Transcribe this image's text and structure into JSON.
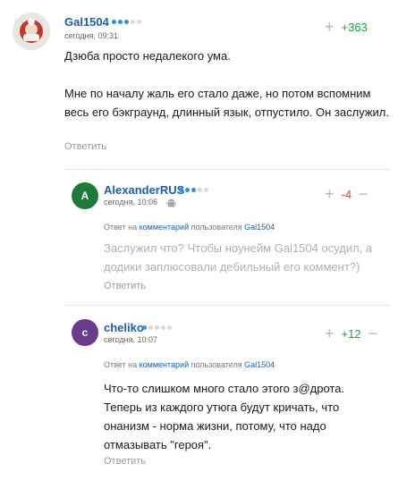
{
  "comments": [
    {
      "username": "Gal1504",
      "date": "сегодня, 09:31",
      "score": "+363",
      "text_p1": "Дзюба просто недалекого ума.",
      "text_p2": "Мне по началу жаль его стало даже, но потом вспомним весь его бэкграунд, длинный язык, отпустило. Он заслужил.",
      "reply_label": "Ответить",
      "rating_level": 3
    },
    {
      "username": "AlexanderRUS",
      "avatar_letter": "A",
      "avatar_color": "#1e7a3a",
      "date": "сегодня, 10:06",
      "score": "-4",
      "reply_to": {
        "prefix": "Ответ на",
        "link": "комментарий",
        "middle": "пользователя",
        "user": "Gal1504"
      },
      "text": "Заслужил что? Чтобы ноунейм Gal1504 осудил, а додики заплюсовали дебильный его коммент?)",
      "reply_label": "Ответить",
      "rating_level": 3
    },
    {
      "username": "cheliko",
      "avatar_letter": "c",
      "avatar_color": "#6a3a8c",
      "date": "сегодня, 10:07",
      "score": "+12",
      "reply_to": {
        "prefix": "Ответ на",
        "link": "комментарий",
        "middle": "пользователя",
        "user": "Gal1504"
      },
      "text": "Что-то слишком много стало этого з@дрота. Теперь из каждого утюга будут кричать, что онанизм - норма жизни, потому, что надо отмазывать \"героя\".",
      "reply_label": "Ответить",
      "rating_level": 1
    }
  ],
  "icons": {
    "plus": "+",
    "minus": "−"
  }
}
